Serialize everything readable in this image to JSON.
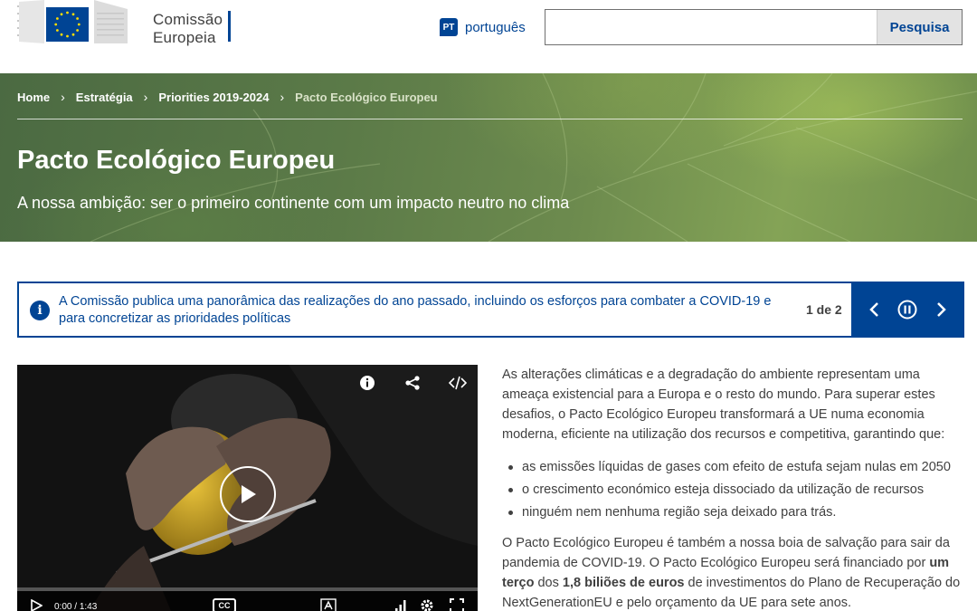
{
  "header": {
    "logo_line1": "Comissão",
    "logo_line2": "Europeia",
    "lang_code": "PT",
    "lang_label": "português",
    "search_placeholder": "",
    "search_button": "Pesquisa"
  },
  "breadcrumb": [
    "Home",
    "Estratégia",
    "Priorities 2019-2024",
    "Pacto Ecológico Europeu"
  ],
  "hero": {
    "title": "Pacto Ecológico Europeu",
    "subtitle": "A nossa ambição: ser o primeiro continente com um impacto neutro no clima"
  },
  "notice": {
    "text": "A Comissão publica uma panorâmica das realizações do ano passado, incluindo os esforços para combater a COVID-19 e para concretizar as prioridades políticas",
    "count": "1 de 2"
  },
  "video": {
    "time_current": "0:00",
    "time_sep": "/",
    "time_total": "1:43",
    "cc_label": "CC"
  },
  "content": {
    "intro": "As alterações climáticas e a degradação do ambiente representam uma ameaça existencial para a Europa e o resto do mundo. Para superar estes desafios, o Pacto Ecológico Europeu transformará a UE numa economia moderna, eficiente na utilização dos recursos e competitiva, garantindo que:",
    "bullets": [
      "as emissões líquidas de gases com efeito de estufa sejam nulas em 2050",
      "o crescimento económico esteja dissociado da utilização de recursos",
      "ninguém nem nenhuma região seja deixado para trás."
    ],
    "p2_a": "O Pacto Ecológico Europeu é também a nossa boia de salvação para sair da pandemia de COVID-19. O Pacto Ecológico Europeu será financiado por ",
    "p2_b": "um terço",
    "p2_c": " dos ",
    "p2_d": "1,8 biliões de euros",
    "p2_e": " de investimentos do Plano de Recuperação do NextGenerationEU e pelo orçamento da UE para sete anos."
  },
  "colors": {
    "brand": "#004494",
    "hero_green": "#5b7a48"
  }
}
